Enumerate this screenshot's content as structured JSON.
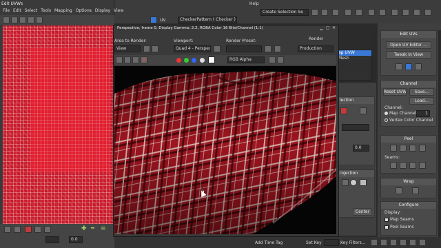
{
  "uv_editor": {
    "title": "Edit UVWs",
    "menu": [
      "File",
      "Edit",
      "Select",
      "Tools",
      "Mapping",
      "Options",
      "Display",
      "View"
    ],
    "uv_label": "UV",
    "texture_select": "CheckerPattern  ( Checker )",
    "bottom_value": "0.0"
  },
  "top_bar": {
    "help_menu": "Help",
    "selection_set": "Create Selection Se"
  },
  "render_frame": {
    "title": "Perspective, frame 0, Display Gamma: 2.2, RGBA Color 16 Bits/Channel (1:1)",
    "area_label": "Area to Render:",
    "area_value": "View",
    "viewport_label": "Viewport:",
    "viewport_value": "Quad 4 - Perspec",
    "preset_label": "Render Preset:",
    "preset_value": "",
    "render_label": "Render",
    "render_value": "Production",
    "channel_value": "RGB Alpha"
  },
  "side_list": {
    "items": [
      "ap UVW",
      "Mesh"
    ]
  },
  "edit_uvs": {
    "title": "Edit UVs",
    "open_editor": "Open UV Editor ...",
    "tweak": "Tweak In View"
  },
  "channel": {
    "title": "Channel",
    "reset": "Reset UVWs",
    "save": "Save...",
    "load": "Load...",
    "channel_label": "Channel:",
    "map_channel": "Map Channel:",
    "map_channel_value": "1",
    "vertex_color": "Vertex Color Channel"
  },
  "peel": {
    "title": "Peel",
    "seams": "Seams:"
  },
  "wrap": {
    "title": "Wrap"
  },
  "configure": {
    "title": "Configure",
    "display": "Display:",
    "map_seams": "Map Seams",
    "peel_seams": "Peel Seams"
  },
  "mid_panel": {
    "selection": "lection",
    "projection": "rojection",
    "value": "0.0",
    "center": "Center"
  },
  "status_bar": {
    "add_time_tag": "Add Time Tag",
    "set_key": "Set Key",
    "key_filters": "Key Filters..."
  },
  "colors": {
    "fabric_red": "#9e1520",
    "checker_red": "#c81a2a",
    "accent_blue": "#3a78d6"
  }
}
